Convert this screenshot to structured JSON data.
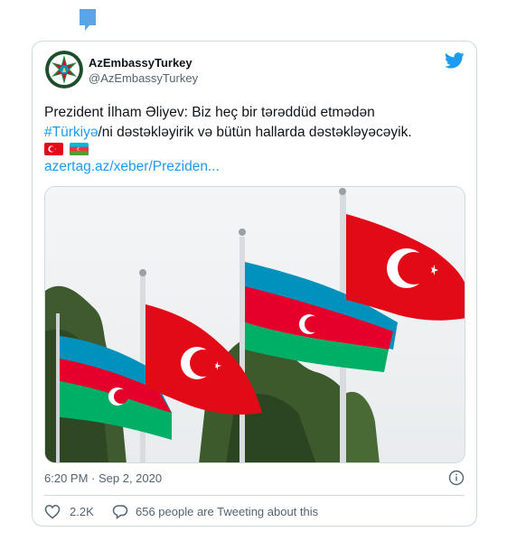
{
  "account": {
    "display_name": "AzEmbassyTurkey",
    "handle": "@AzEmbassyTurkey"
  },
  "tweet": {
    "text_before": "Prezident İlham Əliyev: Biz heç bir tərəddüd etmədən",
    "hashtag": "#Türkiyə",
    "text_after": "/ni dəstəkləyirik və bütün hallarda dəstəkləyəcəyik.",
    "flags": [
      "turkey-flag",
      "azerbaijan-flag"
    ],
    "link": "azertag.az/xeber/Preziden..."
  },
  "meta": {
    "timestamp": "6:20 PM · Sep 2, 2020",
    "like_count": "2.2K",
    "reply_text": "656 people are Tweeting about this"
  },
  "colors": {
    "accent": "#1d9bf0",
    "border": "#cfd9de",
    "secondary_text": "#536471"
  }
}
